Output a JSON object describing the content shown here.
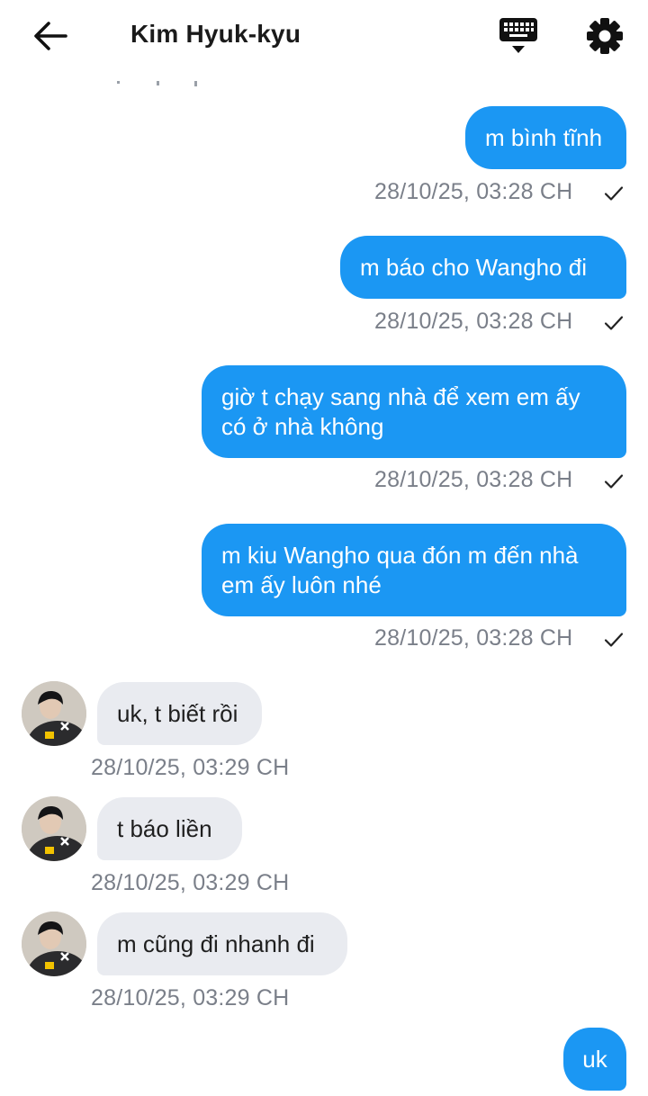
{
  "header": {
    "title": "Kim Hyuk-kyu",
    "back_icon": "arrow-left-icon",
    "keyboard_icon": "keyboard-hide-icon",
    "settings_icon": "gear-icon"
  },
  "colors": {
    "outgoing_bubble": "#1b97f3",
    "incoming_bubble": "#e9ebf0",
    "timestamp": "#7a7f89"
  },
  "messages": [
    {
      "direction": "out",
      "text": "m bình tĩnh",
      "time": "28/10/25, 03:28 CH",
      "status": "sent"
    },
    {
      "direction": "out",
      "text": "m báo cho Wangho đi",
      "time": "28/10/25, 03:28 CH",
      "status": "sent"
    },
    {
      "direction": "out",
      "text_line1": "giờ t chạy sang nhà để xem em ấy",
      "text_line2": "có ở nhà không",
      "time": "28/10/25, 03:28 CH",
      "status": "sent"
    },
    {
      "direction": "out",
      "text_line1": "m kiu Wangho qua đón m đến nhà",
      "text_line2": "em ấy luôn nhé",
      "time": "28/10/25, 03:28 CH",
      "status": "sent"
    },
    {
      "direction": "in",
      "text": "uk, t biết rồi",
      "time": "28/10/25, 03:29 CH"
    },
    {
      "direction": "in",
      "text": "t báo liền",
      "time": "28/10/25, 03:29 CH"
    },
    {
      "direction": "in",
      "text": "m cũng đi nhanh đi",
      "time": "28/10/25, 03:29 CH"
    },
    {
      "direction": "out",
      "text": "uk"
    }
  ]
}
